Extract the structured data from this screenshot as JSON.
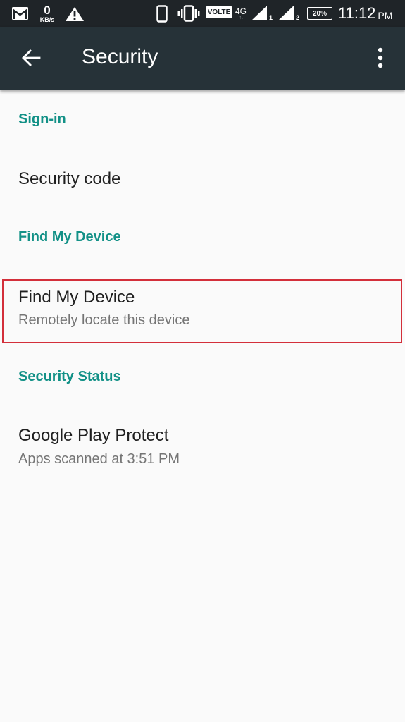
{
  "status_bar": {
    "network_speed_value": "0",
    "network_speed_unit": "KB/s",
    "volte_label": "VOLTE",
    "network_type": "4G",
    "network_arrows": "↑↓",
    "sim1_label": "1",
    "sim2_label": "2",
    "battery_percent": "20%",
    "time": "11:12",
    "ampm": "PM",
    "icons": [
      "gmail-icon",
      "warning-icon",
      "phone-icon",
      "vibrate-icon",
      "signal-icon",
      "signal-icon",
      "battery-icon"
    ]
  },
  "app_bar": {
    "title": "Security",
    "back_icon": "arrow-back-icon",
    "overflow_icon": "more-vert-icon"
  },
  "sections": [
    {
      "header": "Sign-in",
      "items": [
        {
          "title": "Security code"
        }
      ]
    },
    {
      "header": "Find My Device",
      "items": [
        {
          "title": "Find My Device",
          "summary": "Remotely locate this device",
          "highlighted": true
        }
      ]
    },
    {
      "header": "Security Status",
      "items": [
        {
          "title": "Google Play Protect",
          "summary": "Apps scanned at 3:51 PM"
        }
      ]
    }
  ],
  "colors": {
    "status_bar_bg": "#1f2428",
    "app_bar_bg": "#263238",
    "accent": "#139187",
    "background": "#fafafa",
    "highlight_border": "#d32f3a"
  }
}
